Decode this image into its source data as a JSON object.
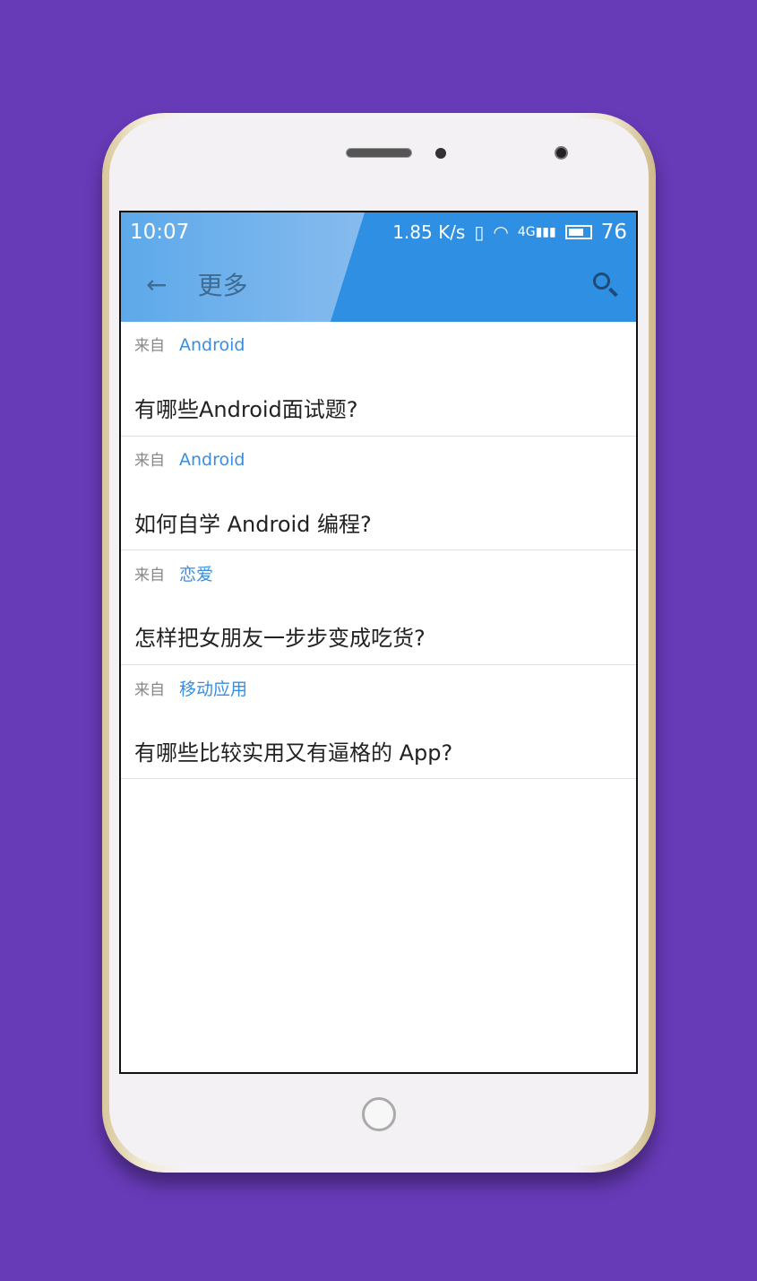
{
  "status": {
    "time": "10:07",
    "speed": "1.85 K/s",
    "network": "4G",
    "battery": "76"
  },
  "toolbar": {
    "title": "更多"
  },
  "items": [
    {
      "from": "来自",
      "topic": "Android",
      "question": "有哪些Android面试题?"
    },
    {
      "from": "来自",
      "topic": "Android",
      "question": "如何自学 Android 编程?"
    },
    {
      "from": "来自",
      "topic": "恋爱",
      "question": "怎样把女朋友一步步变成吃货?"
    },
    {
      "from": "来自",
      "topic": "移动应用",
      "question": "有哪些比较实用又有逼格的 App?"
    }
  ]
}
